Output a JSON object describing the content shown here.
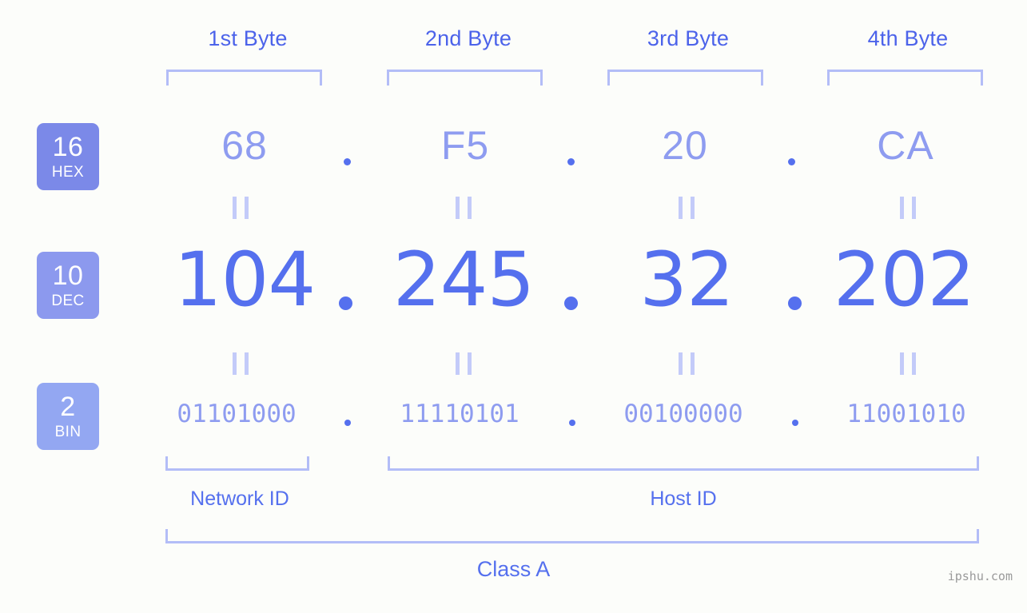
{
  "background": "#fcfdfa",
  "accent": "#5570ee",
  "accent_light": "#8e9cf0",
  "bracket_color": "#b3bdf7",
  "ip_address": "104.245.32.202",
  "byte_headers": [
    {
      "label": "1st Byte"
    },
    {
      "label": "2nd Byte"
    },
    {
      "label": "3rd Byte"
    },
    {
      "label": "4th Byte"
    }
  ],
  "rows": {
    "hex": {
      "badge_num": "16",
      "badge_name": "HEX",
      "badge_color": "#7b89e8",
      "values": [
        "68",
        "F5",
        "20",
        "CA"
      ],
      "separator": "."
    },
    "dec": {
      "badge_num": "10",
      "badge_name": "DEC",
      "badge_color": "#8c99ee",
      "values": [
        "104",
        "245",
        "32",
        "202"
      ],
      "separator": "."
    },
    "bin": {
      "badge_num": "2",
      "badge_name": "BIN",
      "badge_color": "#93a7f2",
      "values": [
        "01101000",
        "11110101",
        "00100000",
        "11001010"
      ],
      "separator": "."
    }
  },
  "equals_marker": "||",
  "id_sections": [
    {
      "label": "Network ID"
    },
    {
      "label": "Host ID"
    }
  ],
  "class_label": "Class A",
  "watermark": "ipshu.com"
}
